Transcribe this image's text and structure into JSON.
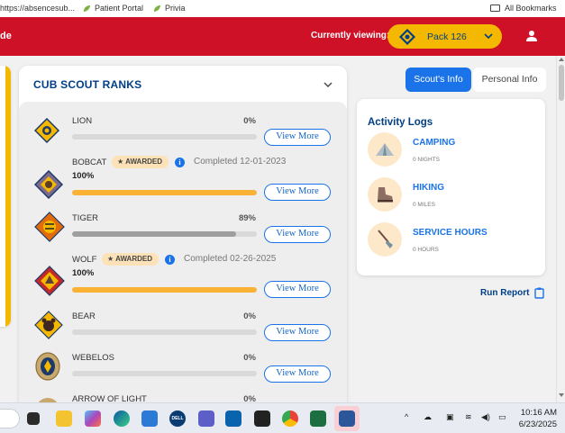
{
  "bookmarks": {
    "url_fragment": "https://absencesub...",
    "patient_portal": "Patient Portal",
    "privia": "Privia",
    "all_bookmarks": "All Bookmarks"
  },
  "header": {
    "left_cut_text": "de",
    "currently_viewing": "Currently viewing:",
    "pack_label": "Pack 126",
    "brand_color": "#ce1126",
    "accent_color": "#f5b800"
  },
  "ranks": {
    "title": "CUB SCOUT RANKS",
    "view_more": "View More",
    "items": [
      {
        "name": "LION",
        "percent": "0%",
        "progress": 0,
        "awarded": false,
        "icon": "lion-badge"
      },
      {
        "name": "BOBCAT",
        "percent": "100%",
        "progress": 100,
        "awarded": true,
        "awarded_label": "AWARDED",
        "completed": "Completed 12-01-2023",
        "icon": "bobcat-badge"
      },
      {
        "name": "TIGER",
        "percent": "89%",
        "progress": 89,
        "awarded": false,
        "icon": "tiger-badge"
      },
      {
        "name": "WOLF",
        "percent": "100%",
        "progress": 100,
        "awarded": true,
        "awarded_label": "AWARDED",
        "completed": "Completed 02-26-2025",
        "icon": "wolf-badge"
      },
      {
        "name": "BEAR",
        "percent": "0%",
        "progress": 0,
        "awarded": false,
        "icon": "bear-badge"
      },
      {
        "name": "WEBELOS",
        "percent": "0%",
        "progress": 0,
        "awarded": false,
        "icon": "webelos-badge"
      },
      {
        "name": "ARROW OF LIGHT",
        "percent": "0%",
        "progress": 0,
        "awarded": false,
        "icon": "arrow-of-light-badge"
      }
    ]
  },
  "tabs": {
    "scouts_info": "Scout's Info",
    "personal_info": "Personal Info",
    "active": "scouts_info"
  },
  "activity_logs": {
    "title": "Activity Logs",
    "items": [
      {
        "label": "CAMPING",
        "value": "0 NIGHTS",
        "icon": "tent-icon"
      },
      {
        "label": "HIKING",
        "value": "0 MILES",
        "icon": "hiking-boot-icon"
      },
      {
        "label": "SERVICE HOURS",
        "value": "0 HOURS",
        "icon": "shovel-icon"
      }
    ]
  },
  "run_report": "Run Report",
  "taskbar": {
    "time": "10:16 AM",
    "date": "6/23/2025",
    "dell_label": "DELL"
  }
}
